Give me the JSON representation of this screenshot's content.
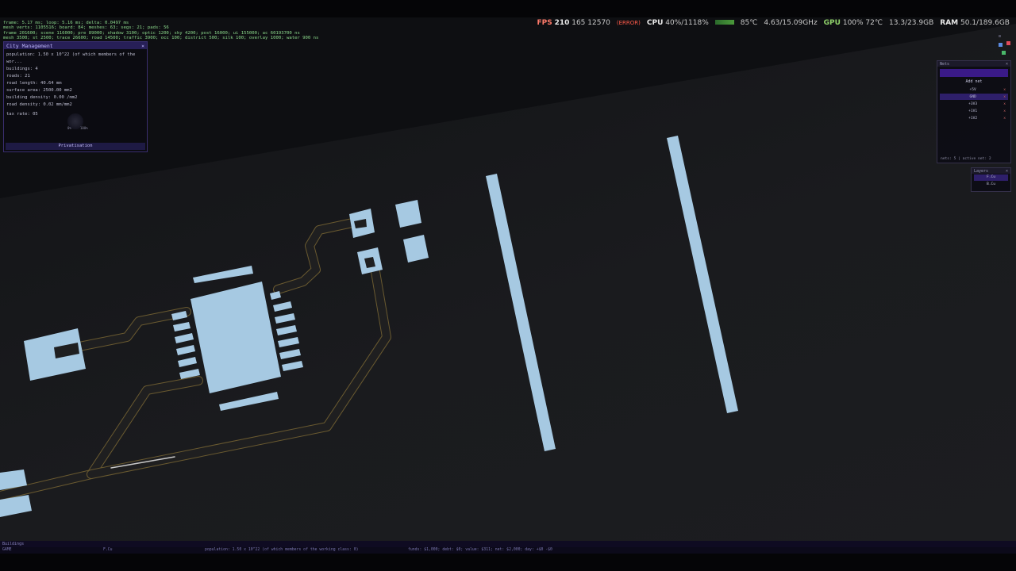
{
  "perf": {
    "fps_label": "FPS",
    "fps": "210",
    "fps_extra": "165 12570",
    "warn": "(ERROR)",
    "cpu_label": "CPU",
    "cpu": "40%/1118%",
    "cpu_temp": "85℃",
    "cpu_clock": "4.63/15.09GHz",
    "gpu_label": "GPU",
    "gpu": "100% 72℃",
    "vram": "13.3/23.9GB",
    "ram_label": "RAM",
    "ram": "50.1/189.6GB"
  },
  "debug": {
    "line1": "frame: 5.17 ms; loop: 5.16 ms; delta: 0.0497 ms",
    "line2": "mesh verts: 1105516; board: 84; meshes: 63; segs: 21; pads: 56",
    "line3": "frame 201600; scene 116000; pre 89000; shadow 3100; optic 1200; sky 4200; post 16000; ui 155000; ac 60193700 ns",
    "line4": "mesh 3500; st 2500; trace 26600; road 14500; traffic 3900; occ 100; district 500; silk 100; overlay 1000; water 900 ns"
  },
  "city": {
    "title": "City Management",
    "close": "×",
    "population": "population: 1.50 x 10^22 (of which members of the wor...",
    "buildings": "buildings: 4",
    "roads": "roads: 21",
    "road_length": "road length: 40.64 mm",
    "surface_area": "surface area: 2500.00 mm2",
    "building_density": "building density: 0.00 /mm2",
    "road_density": "road density: 0.02 mm/mm2",
    "tax_rate": "tax rate: 05",
    "knob_min": "0%",
    "knob_max": "100%",
    "privatisation": "Privatisation"
  },
  "nets": {
    "title": "Nets",
    "close": "×",
    "add_net": "Add net",
    "items": [
      {
        "label": "+5V",
        "active": false
      },
      {
        "label": "GND",
        "active": true
      },
      {
        "label": "+3V3",
        "active": false
      },
      {
        "label": "+1V1",
        "active": false
      },
      {
        "label": "+1V2",
        "active": false
      }
    ],
    "remove": "x",
    "footer": "nets: 5 | active net: 2"
  },
  "layers": {
    "title": "Layers",
    "close": "×",
    "items": [
      {
        "label": "F.Cu",
        "active": true
      },
      {
        "label": "B.Cu",
        "active": false
      }
    ]
  },
  "status": {
    "mode": "Buildings",
    "game": "GAME",
    "layer": "F.Cu",
    "population": "population: 1.50 x 10^22 (of which members of the working class: 0)",
    "economy": "funds: $1,000; debt: $0; value: $311; net: $2,000; day: +$0 -$0"
  },
  "colors": {
    "pad": "#a6c9e2",
    "trace": "#1e1e1f",
    "trace_edge": "#6b5a2a",
    "accent": "#3a1a88"
  }
}
